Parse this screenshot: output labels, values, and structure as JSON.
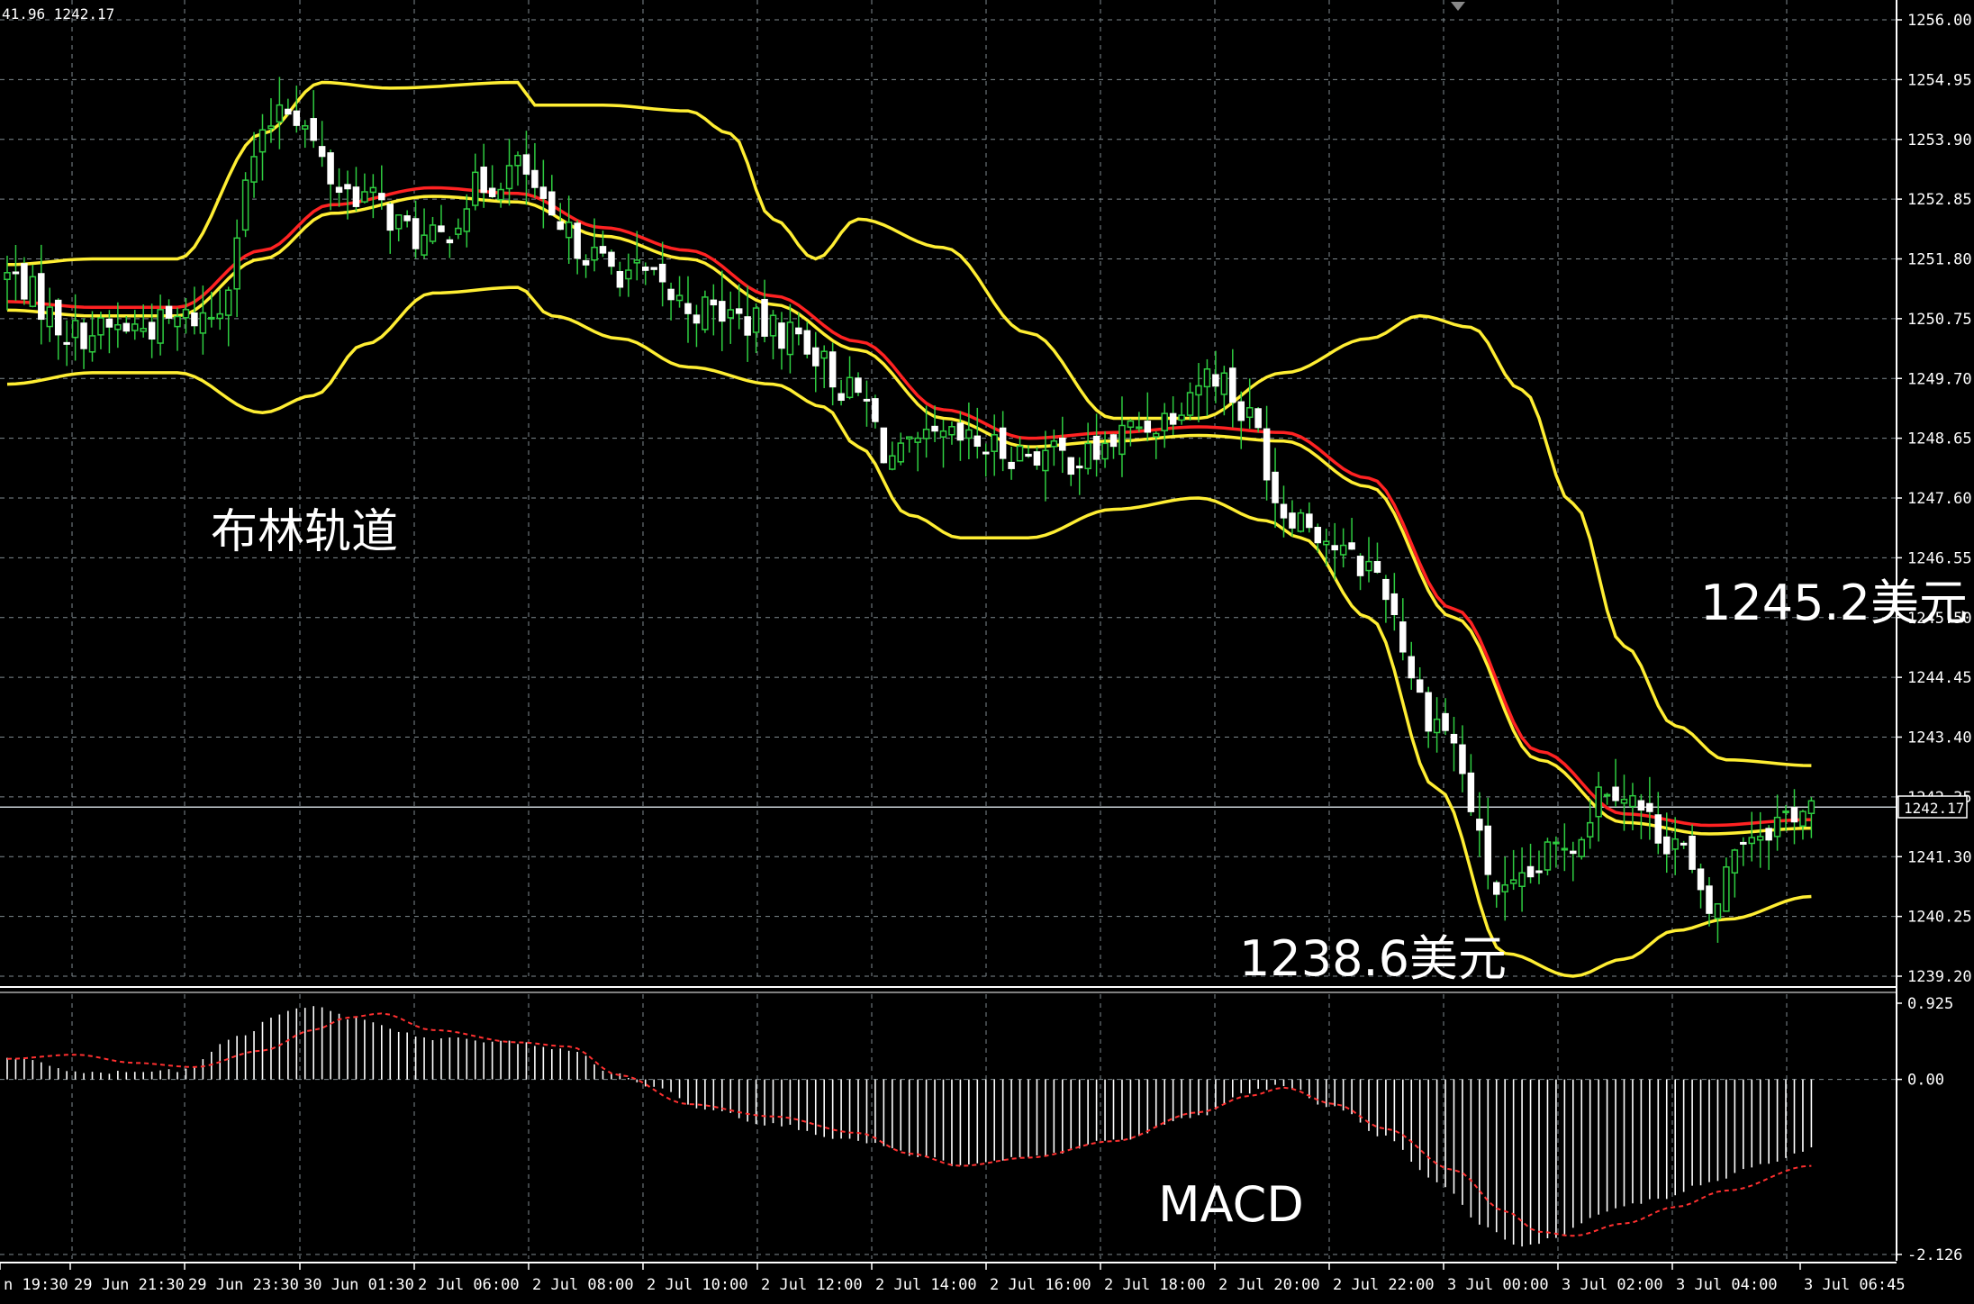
{
  "ohlc_readout": "41.96 1242.17",
  "current_price_label": "1242.17",
  "annotations": {
    "bollinger": "布林轨道",
    "upper_value": "1245.2美元",
    "lower_value": "1238.6美元",
    "macd": "MACD"
  },
  "colors": {
    "background": "#000000",
    "grid": "#7f8a8f",
    "axis": "#ffffff",
    "bull_candle": "#2ecc40",
    "bear_candle": "#ffffff",
    "bollinger": "#ffee33",
    "middle_ma": "#ff2222",
    "macd_histogram": "#ffffff",
    "macd_signal": "#ff3030"
  },
  "chart_data": [
    {
      "type": "candlestick",
      "title": "",
      "ylim": [
        1239.2,
        1256.0
      ],
      "y_ticks": [
        "1256.00",
        "1254.95",
        "1253.90",
        "1252.85",
        "1251.80",
        "1250.75",
        "1249.70",
        "1248.65",
        "1247.60",
        "1246.55",
        "1245.50",
        "1244.45",
        "1243.40",
        "1242.35",
        "1241.30",
        "1240.25",
        "1239.20"
      ],
      "x_ticks": [
        "n 19:30",
        "29 Jun 21:30",
        "29 Jun 23:30",
        "30 Jun 01:30",
        "2 Jul 06:00",
        "2 Jul 08:00",
        "2 Jul 10:00",
        "2 Jul 12:00",
        "2 Jul 14:00",
        "2 Jul 16:00",
        "2 Jul 18:00",
        "2 Jul 20:00",
        "2 Jul 22:00",
        "3 Jul 00:00",
        "3 Jul 02:00",
        "3 Jul 04:00",
        "3 Jul 06:45"
      ],
      "current_price": 1242.17,
      "series_control_points": {
        "close": [
          [
            0,
            1251.5
          ],
          [
            8,
            1250.5
          ],
          [
            15,
            1250.6
          ],
          [
            24,
            1250.8
          ],
          [
            30,
            1253.8
          ],
          [
            32,
            1254.6
          ],
          [
            40,
            1253.0
          ],
          [
            50,
            1252.1
          ],
          [
            56,
            1253.1
          ],
          [
            60,
            1253.4
          ],
          [
            65,
            1252.2
          ],
          [
            72,
            1251.6
          ],
          [
            82,
            1250.9
          ],
          [
            92,
            1250.5
          ],
          [
            100,
            1249.4
          ],
          [
            104,
            1248.3
          ],
          [
            110,
            1248.6
          ],
          [
            120,
            1248.4
          ],
          [
            126,
            1248.3
          ],
          [
            134,
            1248.9
          ],
          [
            142,
            1249.8
          ],
          [
            146,
            1249.0
          ],
          [
            150,
            1247.4
          ],
          [
            160,
            1246.4
          ],
          [
            168,
            1243.7
          ],
          [
            176,
            1240.6
          ],
          [
            184,
            1241.6
          ],
          [
            188,
            1242.6
          ],
          [
            196,
            1241.6
          ],
          [
            200,
            1240.3
          ],
          [
            204,
            1241.7
          ],
          [
            212,
            1242.17
          ]
        ],
        "bollinger_upper": [
          [
            0,
            1251.7
          ],
          [
            10,
            1251.8
          ],
          [
            20,
            1251.8
          ],
          [
            30,
            1254.0
          ],
          [
            37,
            1254.9
          ],
          [
            45,
            1254.8
          ],
          [
            60,
            1254.9
          ],
          [
            62,
            1254.5
          ],
          [
            70,
            1254.5
          ],
          [
            80,
            1254.4
          ],
          [
            85,
            1254.0
          ],
          [
            90,
            1252.5
          ],
          [
            95,
            1251.8
          ],
          [
            100,
            1252.5
          ],
          [
            110,
            1252.0
          ],
          [
            120,
            1250.5
          ],
          [
            130,
            1249.0
          ],
          [
            140,
            1249.0
          ],
          [
            150,
            1249.8
          ],
          [
            160,
            1250.4
          ],
          [
            166,
            1250.8
          ],
          [
            172,
            1250.6
          ],
          [
            178,
            1249.5
          ],
          [
            184,
            1247.5
          ],
          [
            190,
            1245.0
          ],
          [
            196,
            1243.6
          ],
          [
            202,
            1243.0
          ],
          [
            212,
            1242.9
          ]
        ],
        "bollinger_middle": [
          [
            0,
            1250.9
          ],
          [
            10,
            1250.8
          ],
          [
            20,
            1250.8
          ],
          [
            30,
            1251.8
          ],
          [
            38,
            1252.6
          ],
          [
            50,
            1252.9
          ],
          [
            60,
            1252.8
          ],
          [
            70,
            1252.2
          ],
          [
            80,
            1251.8
          ],
          [
            90,
            1251.0
          ],
          [
            100,
            1250.2
          ],
          [
            110,
            1249.0
          ],
          [
            120,
            1248.5
          ],
          [
            130,
            1248.6
          ],
          [
            140,
            1248.7
          ],
          [
            150,
            1248.6
          ],
          [
            160,
            1247.8
          ],
          [
            170,
            1245.5
          ],
          [
            180,
            1243.0
          ],
          [
            190,
            1241.9
          ],
          [
            200,
            1241.7
          ],
          [
            212,
            1241.8
          ]
        ],
        "bollinger_lower": [
          [
            0,
            1249.6
          ],
          [
            10,
            1249.8
          ],
          [
            20,
            1249.8
          ],
          [
            30,
            1249.1
          ],
          [
            36,
            1249.4
          ],
          [
            42,
            1250.3
          ],
          [
            50,
            1251.2
          ],
          [
            60,
            1251.3
          ],
          [
            64,
            1250.8
          ],
          [
            72,
            1250.4
          ],
          [
            80,
            1249.9
          ],
          [
            90,
            1249.6
          ],
          [
            96,
            1249.2
          ],
          [
            100,
            1248.5
          ],
          [
            106,
            1247.3
          ],
          [
            112,
            1246.9
          ],
          [
            120,
            1246.9
          ],
          [
            130,
            1247.4
          ],
          [
            140,
            1247.6
          ],
          [
            148,
            1247.2
          ],
          [
            152,
            1246.9
          ],
          [
            160,
            1245.5
          ],
          [
            168,
            1242.5
          ],
          [
            176,
            1239.6
          ],
          [
            184,
            1239.2
          ],
          [
            190,
            1239.5
          ],
          [
            196,
            1240.0
          ],
          [
            202,
            1240.2
          ],
          [
            212,
            1240.6
          ]
        ]
      }
    },
    {
      "type": "bar",
      "title": "MACD",
      "ylim": [
        -2.126,
        0.925
      ],
      "y_ticks": [
        "0.925",
        "0.00",
        "-2.126"
      ],
      "series_control_points": {
        "histogram": [
          [
            0,
            0.25
          ],
          [
            10,
            0.08
          ],
          [
            20,
            0.1
          ],
          [
            28,
            0.55
          ],
          [
            32,
            0.8
          ],
          [
            36,
            0.9
          ],
          [
            40,
            0.75
          ],
          [
            50,
            0.5
          ],
          [
            60,
            0.45
          ],
          [
            66,
            0.35
          ],
          [
            72,
            0.05
          ],
          [
            76,
            -0.1
          ],
          [
            82,
            -0.35
          ],
          [
            90,
            -0.55
          ],
          [
            100,
            -0.75
          ],
          [
            108,
            -0.95
          ],
          [
            112,
            -1.05
          ],
          [
            120,
            -0.95
          ],
          [
            130,
            -0.75
          ],
          [
            140,
            -0.45
          ],
          [
            146,
            -0.15
          ],
          [
            150,
            -0.08
          ],
          [
            156,
            -0.35
          ],
          [
            162,
            -0.7
          ],
          [
            168,
            -1.25
          ],
          [
            174,
            -1.8
          ],
          [
            178,
            -2.05
          ],
          [
            182,
            -1.9
          ],
          [
            188,
            -1.6
          ],
          [
            194,
            -1.45
          ],
          [
            200,
            -1.25
          ],
          [
            206,
            -1.05
          ],
          [
            212,
            -0.85
          ]
        ],
        "signal": [
          [
            0,
            0.25
          ],
          [
            8,
            0.3
          ],
          [
            15,
            0.2
          ],
          [
            22,
            0.15
          ],
          [
            30,
            0.35
          ],
          [
            36,
            0.6
          ],
          [
            40,
            0.75
          ],
          [
            44,
            0.8
          ],
          [
            50,
            0.6
          ],
          [
            60,
            0.45
          ],
          [
            66,
            0.4
          ],
          [
            72,
            0.05
          ],
          [
            80,
            -0.3
          ],
          [
            90,
            -0.45
          ],
          [
            100,
            -0.65
          ],
          [
            106,
            -0.9
          ],
          [
            112,
            -1.05
          ],
          [
            120,
            -0.95
          ],
          [
            130,
            -0.75
          ],
          [
            140,
            -0.4
          ],
          [
            146,
            -0.2
          ],
          [
            150,
            -0.1
          ],
          [
            156,
            -0.3
          ],
          [
            162,
            -0.6
          ],
          [
            170,
            -1.1
          ],
          [
            176,
            -1.6
          ],
          [
            180,
            -1.85
          ],
          [
            184,
            -1.9
          ],
          [
            190,
            -1.75
          ],
          [
            196,
            -1.55
          ],
          [
            202,
            -1.35
          ],
          [
            212,
            -1.05
          ]
        ]
      }
    }
  ]
}
